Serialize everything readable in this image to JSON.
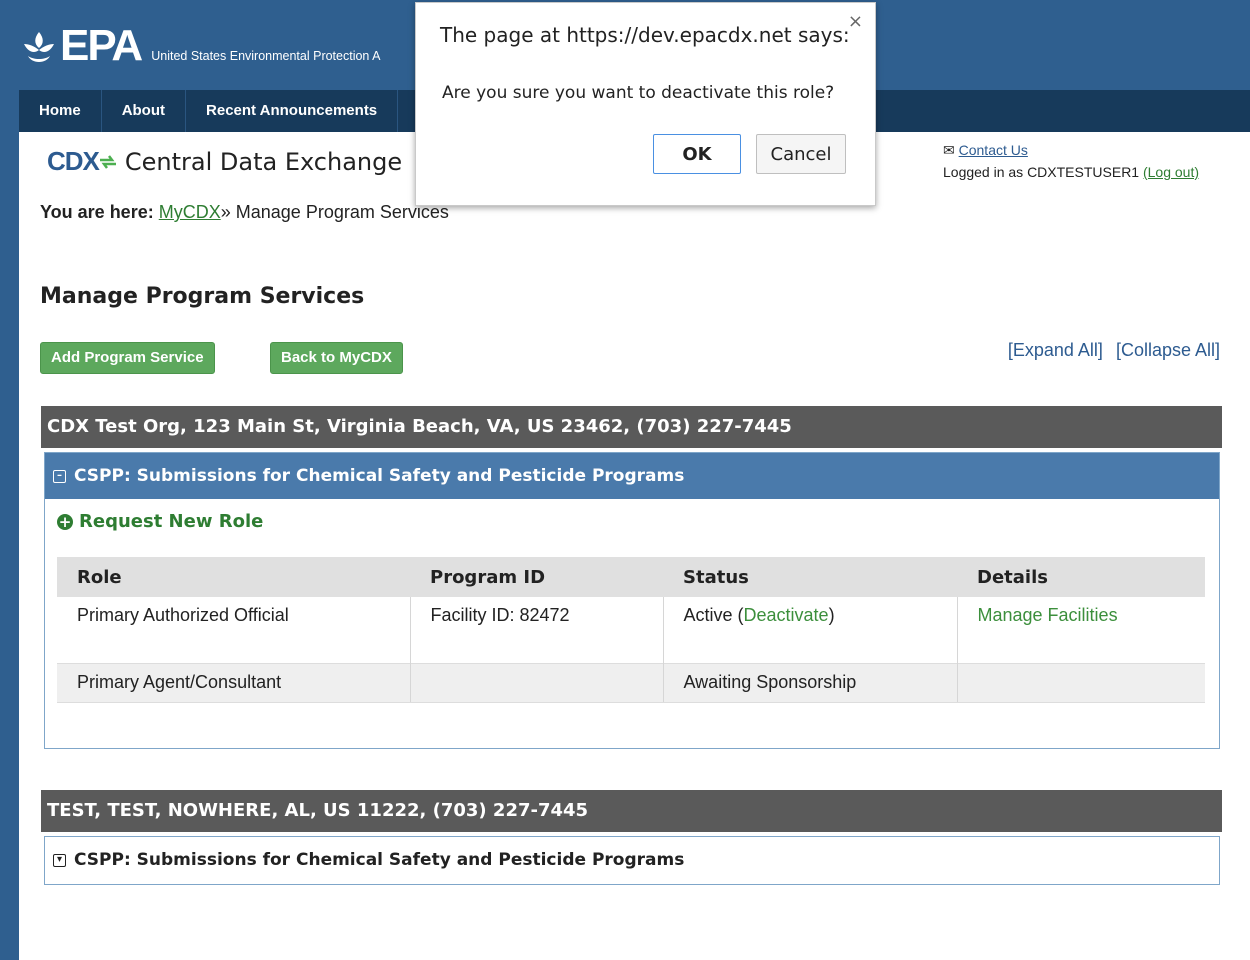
{
  "header": {
    "logo_text": "EPA",
    "logo_subtitle": "United States Environmental Protection A"
  },
  "nav": {
    "items": [
      "Home",
      "About",
      "Recent Announcements"
    ]
  },
  "brand": {
    "mark": "CDX",
    "title": "Central Data Exchange"
  },
  "account": {
    "contact_label": "Contact Us",
    "logged_in_prefix": "Logged in as CDXTESTUSER1",
    "logout_label": "(Log out)"
  },
  "breadcrumb": {
    "label": "You are here:",
    "link": "MyCDX",
    "separator": "»",
    "current": "Manage Program Services"
  },
  "page_title": "Manage Program Services",
  "buttons": {
    "add_program_service": "Add Program Service",
    "back_to_mycdx": "Back to MyCDX",
    "expand_all": "[Expand All]",
    "collapse_all": "[Collapse All]"
  },
  "orgs": [
    {
      "header": "CDX Test Org, 123 Main St, Virginia Beach, VA, US 23462, (703) 227-7445",
      "program": "CSPP: Submissions for Chemical Safety and Pesticide Programs",
      "request_new_role": "Request New Role",
      "columns": [
        "Role",
        "Program ID",
        "Status",
        "Details"
      ],
      "rows": [
        {
          "role": "Primary Authorized Official",
          "program_id": "Facility ID: 82472",
          "status": "Active (",
          "status_link": "Deactivate",
          "status_suffix": ")",
          "details": "Manage Facilities"
        },
        {
          "role": "Primary Agent/Consultant",
          "program_id": "",
          "status": "Awaiting Sponsorship",
          "status_link": "",
          "status_suffix": "",
          "details": ""
        }
      ]
    },
    {
      "header": "TEST, TEST, NOWHERE, AL, US 11222, (703) 227-7445",
      "program": "CSPP: Submissions for Chemical Safety and Pesticide Programs"
    }
  ],
  "dialog": {
    "title": "The page at https://dev.epacdx.net says:",
    "message": "Are you sure you want to deactivate this role?",
    "ok_label": "OK",
    "cancel_label": "Cancel",
    "close_glyph": "×"
  },
  "colors": {
    "header_blue": "#2f5f8f",
    "nav_dark": "#173a5b",
    "green_button": "#5da85d",
    "panel_blue": "#4a7aab",
    "org_bar_gray": "#5a5a5a",
    "link_green": "#2e7d32"
  }
}
